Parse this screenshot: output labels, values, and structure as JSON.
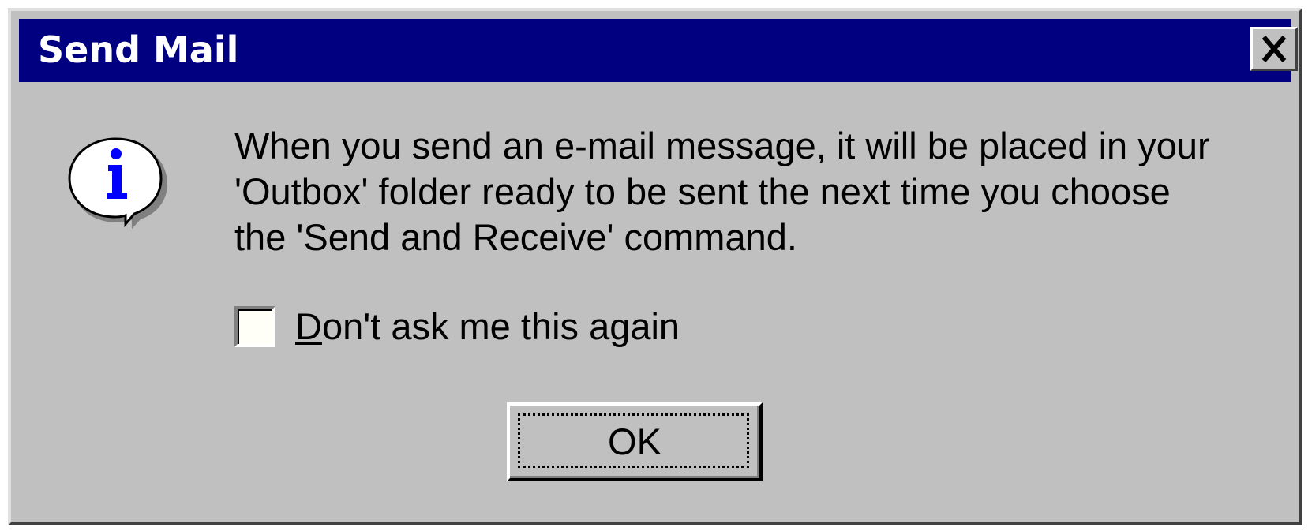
{
  "dialog": {
    "title": "Send Mail",
    "close_icon": "close-icon",
    "icon": "info-icon",
    "message_lines": [
      "When you send an e-mail message, it will be placed in your",
      "'Outbox' folder ready to be sent the next time you choose",
      "the 'Send and Receive' command."
    ],
    "checkbox": {
      "label_mnemonic": "D",
      "label_rest": "on't ask me this again",
      "checked": false
    },
    "ok_label": "OK"
  },
  "colors": {
    "titlebar": "#000080",
    "window_bg": "#c0c0c0",
    "icon_glyph": "#0000ff"
  }
}
